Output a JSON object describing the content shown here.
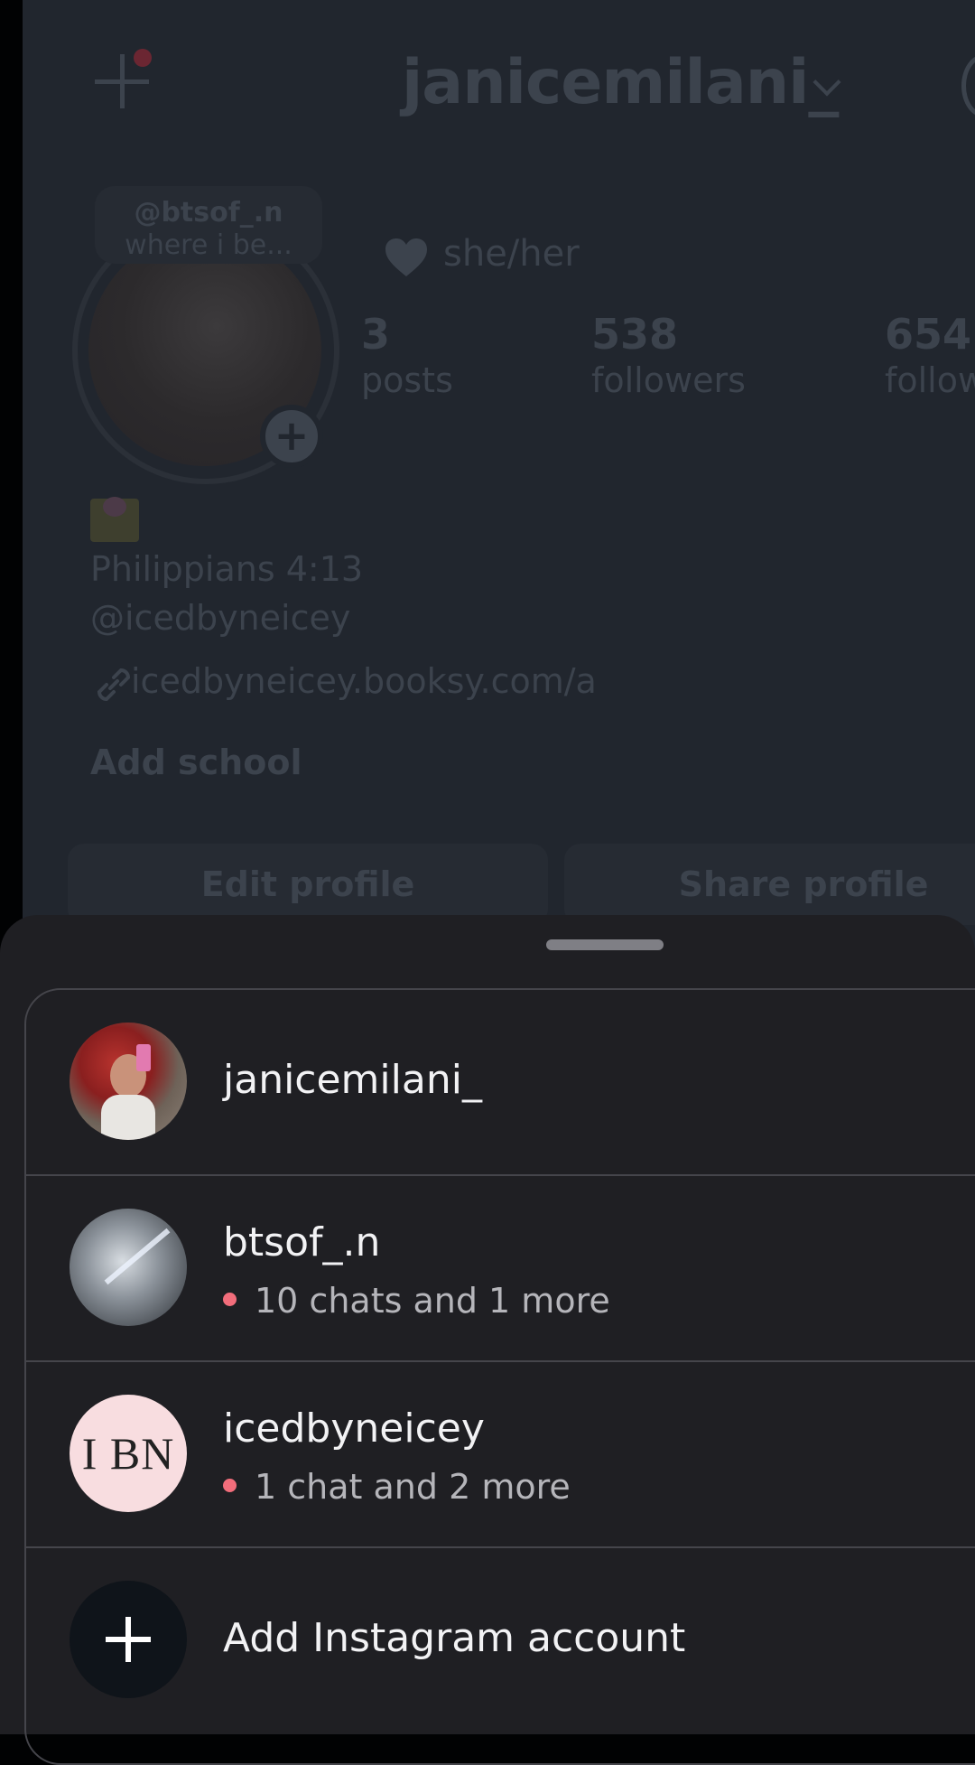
{
  "background_profile": {
    "username": "janicemilani_",
    "note": {
      "handle": "@btsof_.n",
      "text": "where i be..."
    },
    "pronouns": "she/her",
    "stats": [
      {
        "value": "3",
        "label": "posts"
      },
      {
        "value": "538",
        "label": "followers"
      },
      {
        "value": "654",
        "label": "follow"
      }
    ],
    "bio": {
      "line1": "Philippians 4:13",
      "mention": "@icedbyneicey",
      "link": "icedbyneicey.booksy.com/a",
      "add_school": "Add school"
    },
    "buttons": {
      "edit": "Edit profile",
      "share": "Share profile"
    }
  },
  "account_sheet": {
    "accounts": [
      {
        "username": "janicemilani_",
        "status": ""
      },
      {
        "username": "btsof_.n",
        "status": "10 chats and 1 more"
      },
      {
        "username": "icedbyneicey",
        "status": "1 chat and 2 more",
        "avatar_text": "I BN"
      }
    ],
    "add_account_label": "Add Instagram account"
  },
  "colors": {
    "notification_dot": "#f26d7b",
    "sheet_bg": "#1f1f23",
    "profile_bg": "#21262e"
  }
}
